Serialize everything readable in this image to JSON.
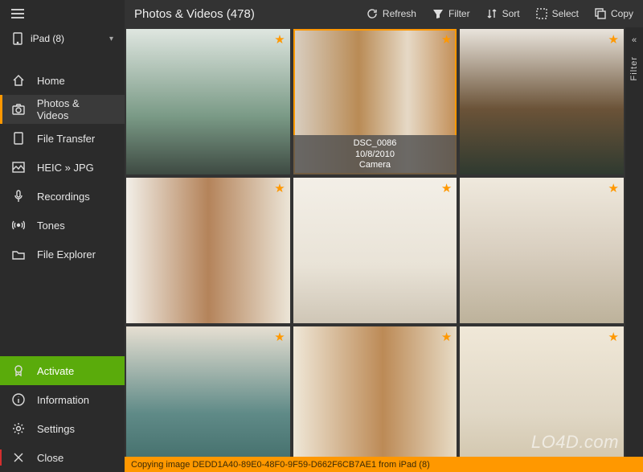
{
  "device": {
    "name": "iPad (8)"
  },
  "sidebar": {
    "items": [
      {
        "label": "Home"
      },
      {
        "label": "Photos & Videos"
      },
      {
        "label": "File Transfer"
      },
      {
        "label": "HEIC » JPG"
      },
      {
        "label": "Recordings"
      },
      {
        "label": "Tones"
      },
      {
        "label": "File Explorer"
      }
    ],
    "bottom": {
      "activate": "Activate",
      "information": "Information",
      "settings": "Settings",
      "close": "Close"
    }
  },
  "header": {
    "title": "Photos & Videos (478)",
    "refresh": "Refresh",
    "filter": "Filter",
    "sort": "Sort",
    "select": "Select",
    "copy": "Copy"
  },
  "rightRail": {
    "filter": "Filter"
  },
  "selectedThumb": {
    "name": "DSC_0086",
    "date": "10/8/2010",
    "source": "Camera"
  },
  "status": {
    "text": "Copying image DEDD1A40-89E0-48F0-9F59-D662F6CB7AE1 from iPad (8)"
  },
  "watermark": "LO4D.com",
  "colors": {
    "accent": "#ff9800",
    "activate": "#5aab0b"
  }
}
